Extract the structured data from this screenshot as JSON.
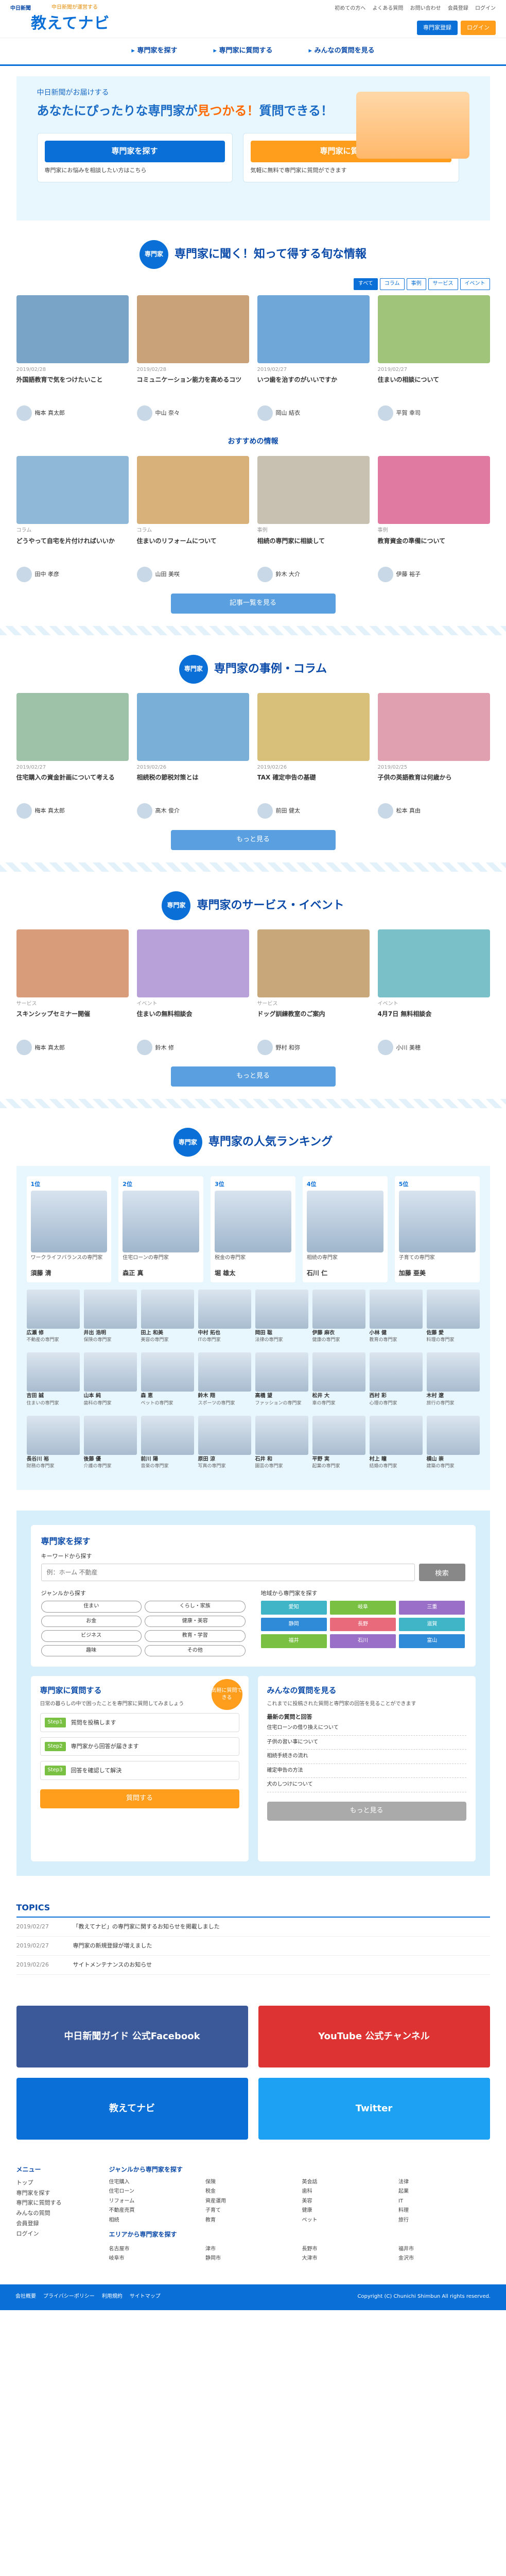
{
  "header": {
    "small_logo": "中日新聞",
    "logo_sub": "中日新聞が運営する",
    "logo": "教えてナビ",
    "top_links": [
      "初めての方へ",
      "よくある質問",
      "お問い合わせ",
      "会員登録",
      "ログイン"
    ],
    "btn_register": "専門家登録",
    "btn_login": "ログイン"
  },
  "nav": [
    "専門家を探す",
    "専門家に質問する",
    "みんなの質問を見る"
  ],
  "hero": {
    "line1": "中日新聞がお届けする",
    "line2a": "あなたにぴったりな専門家が",
    "line2b": "見つかる！",
    "line2c": "質問できる！",
    "card1_btn": "専門家を探す",
    "card1_text": "専門家にお悩みを相談したい方はこちら",
    "card2_btn": "専門家に質問する",
    "card2_text": "気軽に無料で専門家に質問ができます",
    "badge": "無料"
  },
  "sec1": {
    "badge": "専門家",
    "title": "専門家に聞く！知って得する旬な情報",
    "tabs": [
      "すべて",
      "コラム",
      "事例",
      "サービス",
      "イベント"
    ],
    "cards": [
      {
        "meta": "2019/02/28",
        "title": "外国語教育で気をつけたいこと",
        "author": "梅本 真太郎",
        "img": "#7aa3c8"
      },
      {
        "meta": "2019/02/28",
        "title": "コミュニケーション能力を高めるコツ",
        "author": "中山 奈々",
        "img": "#c9a27a"
      },
      {
        "meta": "2019/02/27",
        "title": "いつ歯を治すのがいいですか",
        "author": "岡山 結衣",
        "img": "#6fa8d8"
      },
      {
        "meta": "2019/02/27",
        "title": "住まいの相談について",
        "author": "平賀 幸司",
        "img": "#a0c47a"
      }
    ]
  },
  "sec1b": {
    "heading": "おすすめの情報",
    "cards": [
      {
        "meta": "コラム",
        "title": "どうやって自宅を片付ければいいか",
        "author": "田中 孝彦",
        "img": "#8fb8d8"
      },
      {
        "meta": "コラム",
        "title": "住まいのリフォームについて",
        "author": "山田 美咲",
        "img": "#d8b07a"
      },
      {
        "meta": "事例",
        "title": "相続の専門家に相談して",
        "author": "鈴木 大介",
        "img": "#c8c0b0"
      },
      {
        "meta": "事例",
        "title": "教育資金の準備について",
        "author": "伊藤 裕子",
        "img": "#e07aa0"
      }
    ],
    "more": "記事一覧を見る"
  },
  "sec2": {
    "badge": "専門家",
    "title": "専門家の事例・コラム",
    "cards": [
      {
        "meta": "2019/02/27",
        "title": "住宅購入の資金計画について考える",
        "author": "梅本 真太郎",
        "img": "#9ec2a8"
      },
      {
        "meta": "2019/02/26",
        "title": "相続税の節税対策とは",
        "author": "高木 俊介",
        "img": "#7ab0d8"
      },
      {
        "meta": "2019/02/26",
        "title": "TAX 確定申告の基礎",
        "author": "前田 健太",
        "img": "#d8c07a"
      },
      {
        "meta": "2019/02/25",
        "title": "子供の英語教育は何歳から",
        "author": "松本 真由",
        "img": "#e0a0b0"
      }
    ],
    "more": "もっと見る"
  },
  "sec3": {
    "badge": "専門家",
    "title": "専門家のサービス・イベント",
    "cards": [
      {
        "meta": "サービス",
        "title": "スキンシップセミナー開催",
        "author": "梅本 真太郎",
        "img": "#d89c7a"
      },
      {
        "meta": "イベント",
        "title": "住まいの無料相談会",
        "author": "鈴木 修",
        "img": "#b8a0d8"
      },
      {
        "meta": "サービス",
        "title": "ドッグ訓練教室のご案内",
        "author": "野村 和弥",
        "img": "#c8a87a"
      },
      {
        "meta": "イベント",
        "title": "4月7日 無料相談会",
        "author": "小川 美穂",
        "img": "#7ac0c8"
      }
    ],
    "more": "もっと見る"
  },
  "rank": {
    "badge": "専門家",
    "title": "専門家の人気ランキング",
    "top": [
      {
        "no": "1位",
        "cat": "ワークライフバランスの専門家",
        "name": "須藤 清"
      },
      {
        "no": "2位",
        "cat": "住宅ローンの専門家",
        "name": "森正 真"
      },
      {
        "no": "3位",
        "cat": "税金の専門家",
        "name": "堀 雄太"
      },
      {
        "no": "4位",
        "cat": "相続の専門家",
        "name": "石川 仁"
      },
      {
        "no": "5位",
        "cat": "子育ての専門家",
        "name": "加藤 亜美"
      }
    ],
    "others": [
      {
        "name": "広瀬 修",
        "cat": "不動産の専門家"
      },
      {
        "name": "井出 浩明",
        "cat": "保険の専門家"
      },
      {
        "name": "田上 和美",
        "cat": "美容の専門家"
      },
      {
        "name": "中村 拓也",
        "cat": "ITの専門家"
      },
      {
        "name": "岡田 聡",
        "cat": "法律の専門家"
      },
      {
        "name": "伊藤 麻衣",
        "cat": "健康の専門家"
      },
      {
        "name": "小林 健",
        "cat": "教育の専門家"
      },
      {
        "name": "佐藤 愛",
        "cat": "料理の専門家"
      },
      {
        "name": "吉田 誠",
        "cat": "住まいの専門家"
      },
      {
        "name": "山本 純",
        "cat": "歯科の専門家"
      },
      {
        "name": "森 恵",
        "cat": "ペットの専門家"
      },
      {
        "name": "鈴木 翔",
        "cat": "スポーツの専門家"
      },
      {
        "name": "高橋 望",
        "cat": "ファッションの専門家"
      },
      {
        "name": "松井 大",
        "cat": "車の専門家"
      },
      {
        "name": "西村 彩",
        "cat": "心理の専門家"
      },
      {
        "name": "木村 遼",
        "cat": "旅行の専門家"
      },
      {
        "name": "長谷川 裕",
        "cat": "財務の専門家"
      },
      {
        "name": "後藤 優",
        "cat": "介護の専門家"
      },
      {
        "name": "前川 陽",
        "cat": "音楽の専門家"
      },
      {
        "name": "原田 涼",
        "cat": "写真の専門家"
      },
      {
        "name": "石井 和",
        "cat": "園芸の専門家"
      },
      {
        "name": "平野 実",
        "cat": "起業の専門家"
      },
      {
        "name": "村上 瞳",
        "cat": "結婚の専門家"
      },
      {
        "name": "横山 崇",
        "cat": "建築の専門家"
      }
    ]
  },
  "search": {
    "title": "専門家を探す",
    "kw_label": "キーワードから探す",
    "kw_placeholder": "例：ホーム 不動産",
    "kw_button": "検索",
    "genre_label": "ジャンルから探す",
    "genres": [
      "住まい",
      "くらし・家族",
      "お金",
      "健康・美容",
      "ビジネス",
      "教育・学習",
      "趣味",
      "その他"
    ],
    "area_label": "地域から専門家を探す",
    "areas": [
      "愛知",
      "岐阜",
      "三重",
      "静岡",
      "長野",
      "滋賀",
      "福井",
      "石川",
      "富山"
    ]
  },
  "ask": {
    "title": "専門家に質問する",
    "desc": "日常の暮らしの中で困ったことを専門家に質問してみましょう",
    "badge": "気軽に質問できる",
    "steps": [
      {
        "s": "Step1",
        "t": "質問を投稿します"
      },
      {
        "s": "Step2",
        "t": "専門家から回答が届きます"
      },
      {
        "s": "Step3",
        "t": "回答を確認して解決"
      }
    ],
    "btn": "質問する"
  },
  "qa": {
    "title": "みんなの質問を見る",
    "desc": "これまでに投稿された質問と専門家の回答を見ることができます",
    "latest": "最新の質問と回答",
    "items": [
      "住宅ローンの借り換えについて",
      "子供の習い事について",
      "相続手続きの流れ",
      "確定申告の方法",
      "犬のしつけについて"
    ],
    "btn": "もっと見る"
  },
  "topics": {
    "title": "TOPICS",
    "rows": [
      {
        "d": "2019/02/27",
        "t": "「教えてナビ」の専門家に関するお知らせを掲載しました"
      },
      {
        "d": "2019/02/27",
        "t": "専門家の新規登録が増えました"
      },
      {
        "d": "2019/02/26",
        "t": "サイトメンテナンスのお知らせ"
      }
    ]
  },
  "banners": [
    {
      "t": "中日新聞ガイド 公式Facebook",
      "c": "#3b5998"
    },
    {
      "t": "YouTube 公式チャンネル",
      "c": "#d33"
    },
    {
      "t": "教えてナビ",
      "c": "#0a6fd6"
    },
    {
      "t": "Twitter",
      "c": "#1da1f2"
    }
  ],
  "footer": {
    "left_title": "メニュー",
    "left": [
      "トップ",
      "専門家を探す",
      "専門家に質問する",
      "みんなの質問",
      "会員登録",
      "ログイン"
    ],
    "col_title": "ジャンルから専門家を探す",
    "list": [
      "住宅購入",
      "住宅ローン",
      "リフォーム",
      "不動産売買",
      "相続",
      "保険",
      "税金",
      "資産運用",
      "子育て",
      "教育",
      "英会話",
      "歯科",
      "美容",
      "健康",
      "ペット",
      "法律",
      "起業",
      "IT",
      "料理",
      "旅行"
    ],
    "area_title": "エリアから専門家を探す",
    "area_list": [
      "名古屋市",
      "岐阜市",
      "津市",
      "静岡市",
      "長野市",
      "大津市",
      "福井市",
      "金沢市"
    ]
  },
  "copyright": {
    "links": [
      "会社概要",
      "プライバシーポリシー",
      "利用規約",
      "サイトマップ"
    ],
    "text": "Copyright (C) Chunichi Shimbun All rights reserved."
  }
}
